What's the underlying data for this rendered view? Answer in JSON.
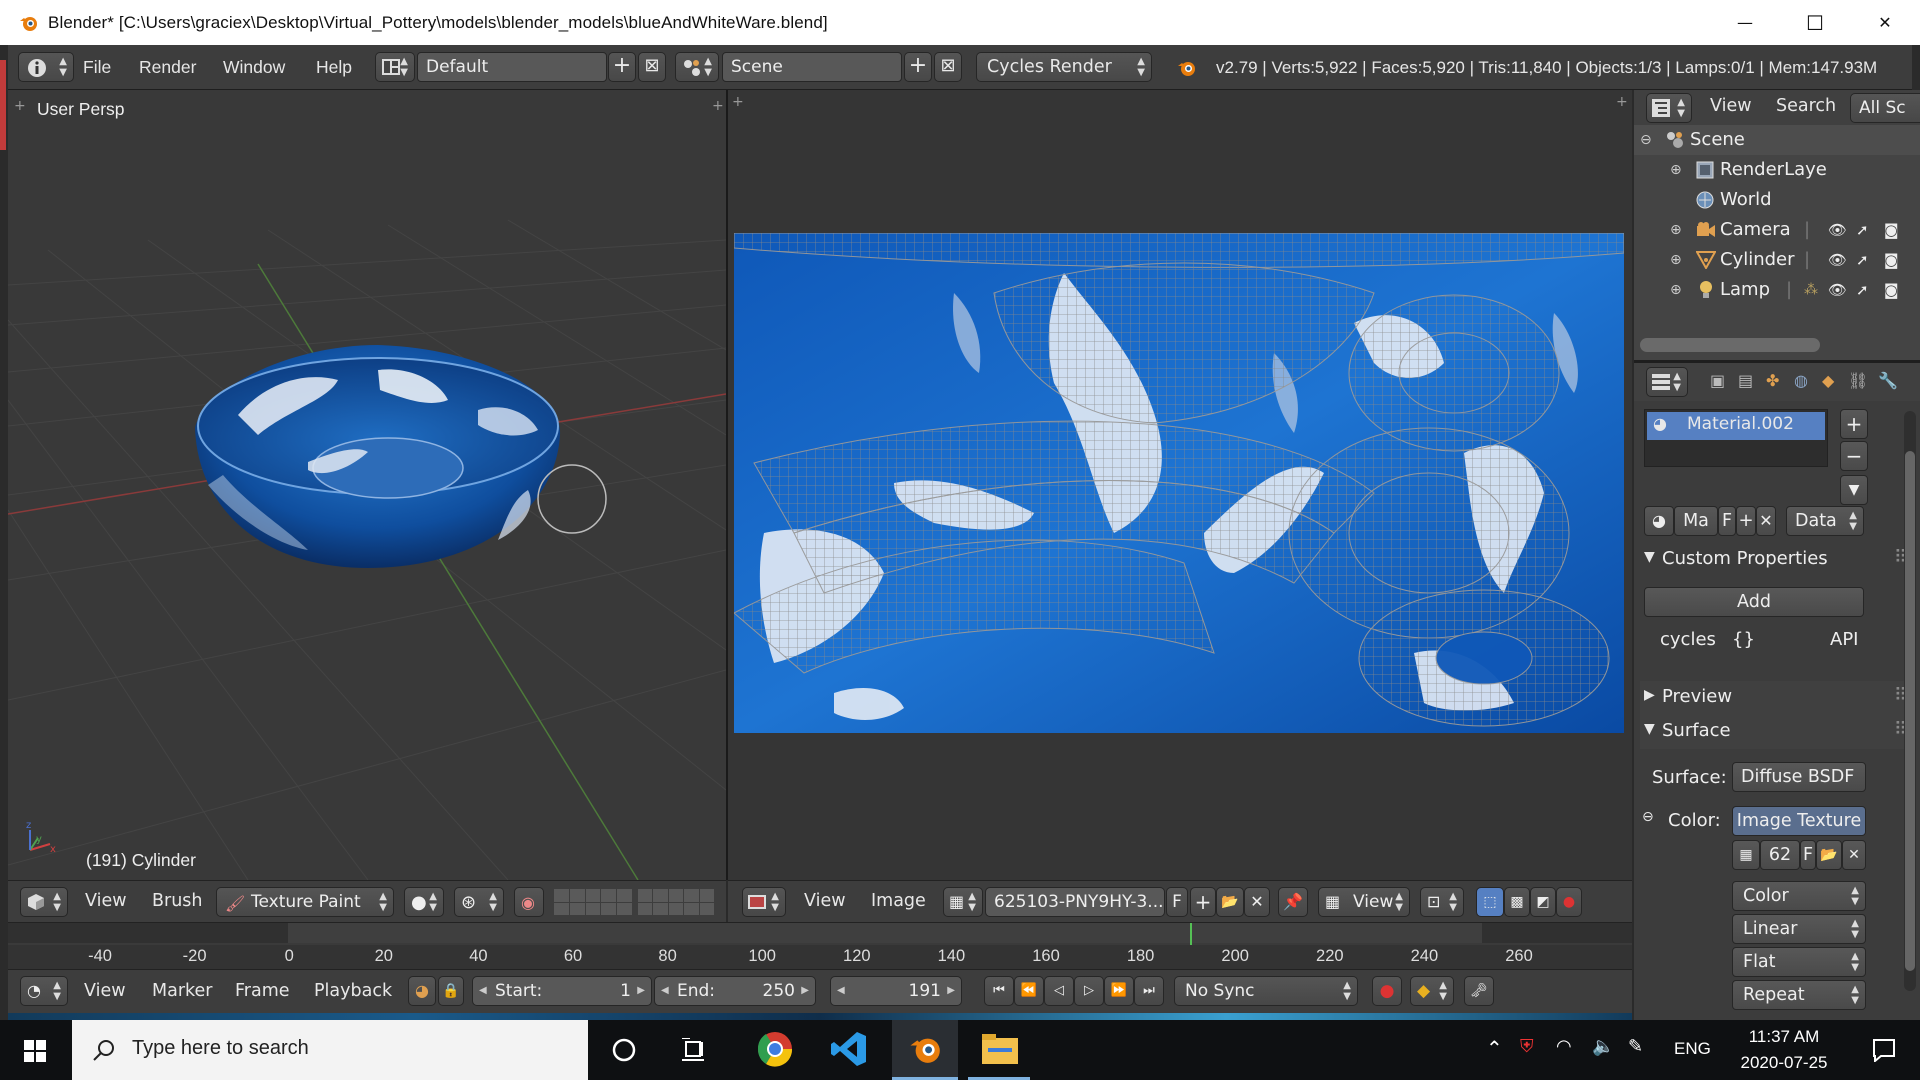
{
  "window": {
    "title": "Blender* [C:\\Users\\graciex\\Desktop\\Virtual_Pottery\\models\\blender_models\\blueAndWhiteWare.blend]",
    "minimize": "—",
    "maximize": "☐",
    "close": "✕"
  },
  "info_header": {
    "menus": [
      "File",
      "Render",
      "Window",
      "Help"
    ],
    "layout": "Default",
    "scene": "Scene",
    "engine": "Cycles Render",
    "stats": "v2.79 | Verts:5,922 | Faces:5,920 | Tris:11,840 | Objects:1/3 | Lamps:0/1 | Mem:147.93M"
  },
  "view3d": {
    "label": "User Persp",
    "object_label": "(191) Cylinder",
    "header": {
      "menus": [
        "View",
        "Brush"
      ],
      "mode": "Texture Paint"
    }
  },
  "image_editor": {
    "header": {
      "menus": [
        "View",
        "Image"
      ],
      "image_name": "625103-PNY9HY-3...",
      "fake_user": "F",
      "view_dropdown": "View"
    }
  },
  "outliner": {
    "header": {
      "view": "View",
      "search": "Search",
      "filter": "All Sc"
    },
    "items": [
      {
        "label": "Scene",
        "icon": "scene-icon"
      },
      {
        "label": "RenderLaye",
        "icon": "render-layers-icon"
      },
      {
        "label": "World",
        "icon": "world-icon"
      },
      {
        "label": "Camera",
        "icon": "camera-icon"
      },
      {
        "label": "Cylinder",
        "icon": "mesh-icon"
      },
      {
        "label": "Lamp",
        "icon": "lamp-icon"
      }
    ]
  },
  "properties": {
    "material_name": "Material.002",
    "ma_label": "Ma",
    "f_label": "F",
    "data_dropdown": "Data",
    "custom_properties": "Custom Properties",
    "add": "Add",
    "cycles": "cycles",
    "braces": "{}",
    "api": "API",
    "preview": "Preview",
    "surface_panel": "Surface",
    "surface_label": "Surface:",
    "surface_value": "Diffuse BSDF",
    "color_label": "Color:",
    "color_value": "Image Texture",
    "image_users": "62",
    "image_f": "F",
    "dropdowns": [
      "Color",
      "Linear",
      "Flat",
      "Repeat"
    ]
  },
  "timeline": {
    "ticks": [
      "-40",
      "-20",
      "0",
      "20",
      "40",
      "60",
      "80",
      "100",
      "120",
      "140",
      "160",
      "180",
      "200",
      "220",
      "240",
      "260"
    ],
    "current_frame_value": 191,
    "menus": [
      "View",
      "Marker",
      "Frame",
      "Playback"
    ],
    "start_label": "Start:",
    "start_value": "1",
    "end_label": "End:",
    "end_value": "250",
    "frame_value": "191",
    "sync": "No Sync"
  },
  "taskbar": {
    "search_placeholder": "Type here to search",
    "language": "ENG",
    "time": "11:37 AM",
    "date": "2020-07-25"
  },
  "colors": {
    "blender_bg": "#393939",
    "header_bg": "#3d3d3d",
    "selection_blue": "#5680c2",
    "taskbar": "#0e1012"
  }
}
